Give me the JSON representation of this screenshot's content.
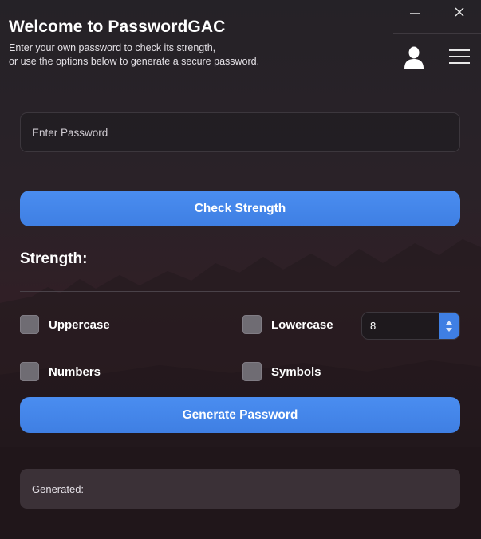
{
  "header": {
    "title": "Welcome to PasswordGAC",
    "subtitle_line1": "Enter your own password to check its strength,",
    "subtitle_line2": "or use the options below to generate a secure password."
  },
  "window": {
    "minimize_icon": "minimize-icon",
    "close_icon": "close-icon"
  },
  "toolbar": {
    "user_icon": "user-icon",
    "menu_icon": "hamburger-menu-icon"
  },
  "password_input": {
    "placeholder": "Enter Password",
    "value": ""
  },
  "buttons": {
    "check_strength": "Check Strength",
    "generate_password": "Generate Password"
  },
  "strength": {
    "label": "Strength:"
  },
  "options": {
    "uppercase": "Uppercase",
    "lowercase": "Lowercase",
    "numbers": "Numbers",
    "symbols": "Symbols"
  },
  "length": {
    "value": "8"
  },
  "generated": {
    "label": "Generated:"
  },
  "colors": {
    "accent": "#3f7fe3",
    "background": "#2a2228",
    "checkbox": "#6f6c73"
  }
}
